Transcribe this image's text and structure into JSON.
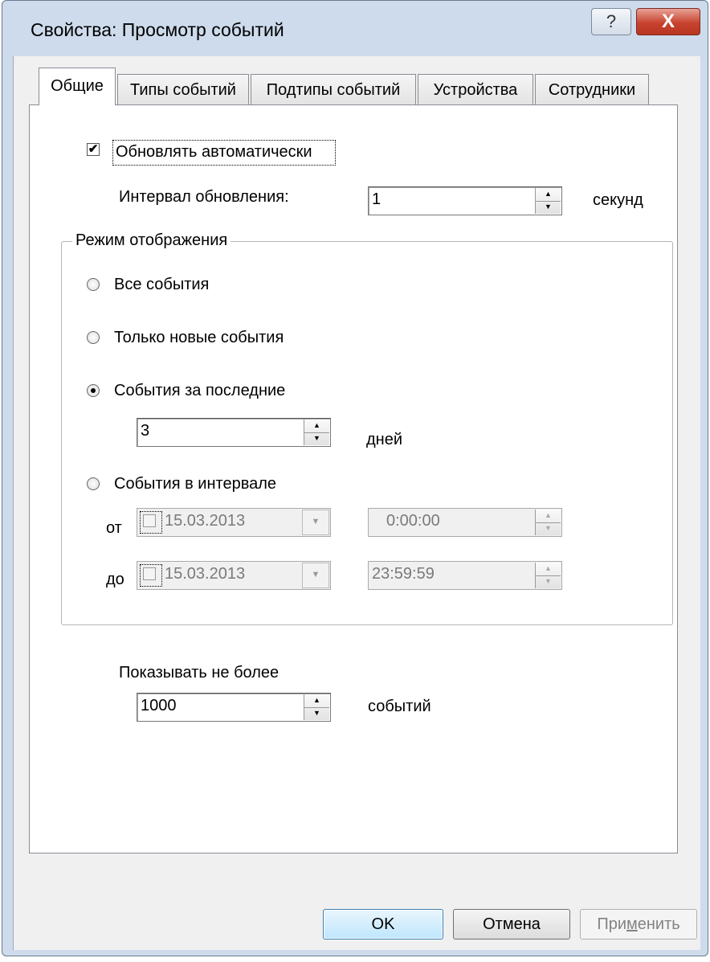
{
  "window": {
    "title": "Свойства: Просмотр событий",
    "help_label": "?",
    "close_label": "X"
  },
  "tabs": [
    {
      "label": "Общие",
      "active": true
    },
    {
      "label": "Типы событий",
      "active": false
    },
    {
      "label": "Подтипы событий",
      "active": false
    },
    {
      "label": "Устройства",
      "active": false
    },
    {
      "label": "Сотрудники",
      "active": false
    }
  ],
  "general": {
    "auto_refresh": {
      "label": "Обновлять автоматически",
      "checked": true
    },
    "interval": {
      "label": "Интервал обновления:",
      "value": "1",
      "unit": "секунд"
    },
    "display_mode": {
      "legend": "Режим отображения",
      "options": [
        {
          "label": "Все события",
          "selected": false
        },
        {
          "label": "Только новые события",
          "selected": false
        },
        {
          "label": "События за последние",
          "selected": true
        },
        {
          "label": "События в интервале",
          "selected": false
        }
      ],
      "last_days": {
        "value": "3",
        "unit": "дней"
      },
      "range": {
        "from": {
          "label": "от",
          "date": "15.03.2013",
          "time": "0:00:00",
          "checked": false
        },
        "to": {
          "label": "до",
          "date": "15.03.2013",
          "time": "23:59:59",
          "checked": false
        }
      }
    },
    "max_events": {
      "label": "Показывать не более",
      "value": "1000",
      "unit": "событий"
    }
  },
  "buttons": {
    "ok": "OK",
    "cancel": "Отмена",
    "apply_prefix": "При",
    "apply_mnemonic": "м",
    "apply_suffix": "енить"
  }
}
